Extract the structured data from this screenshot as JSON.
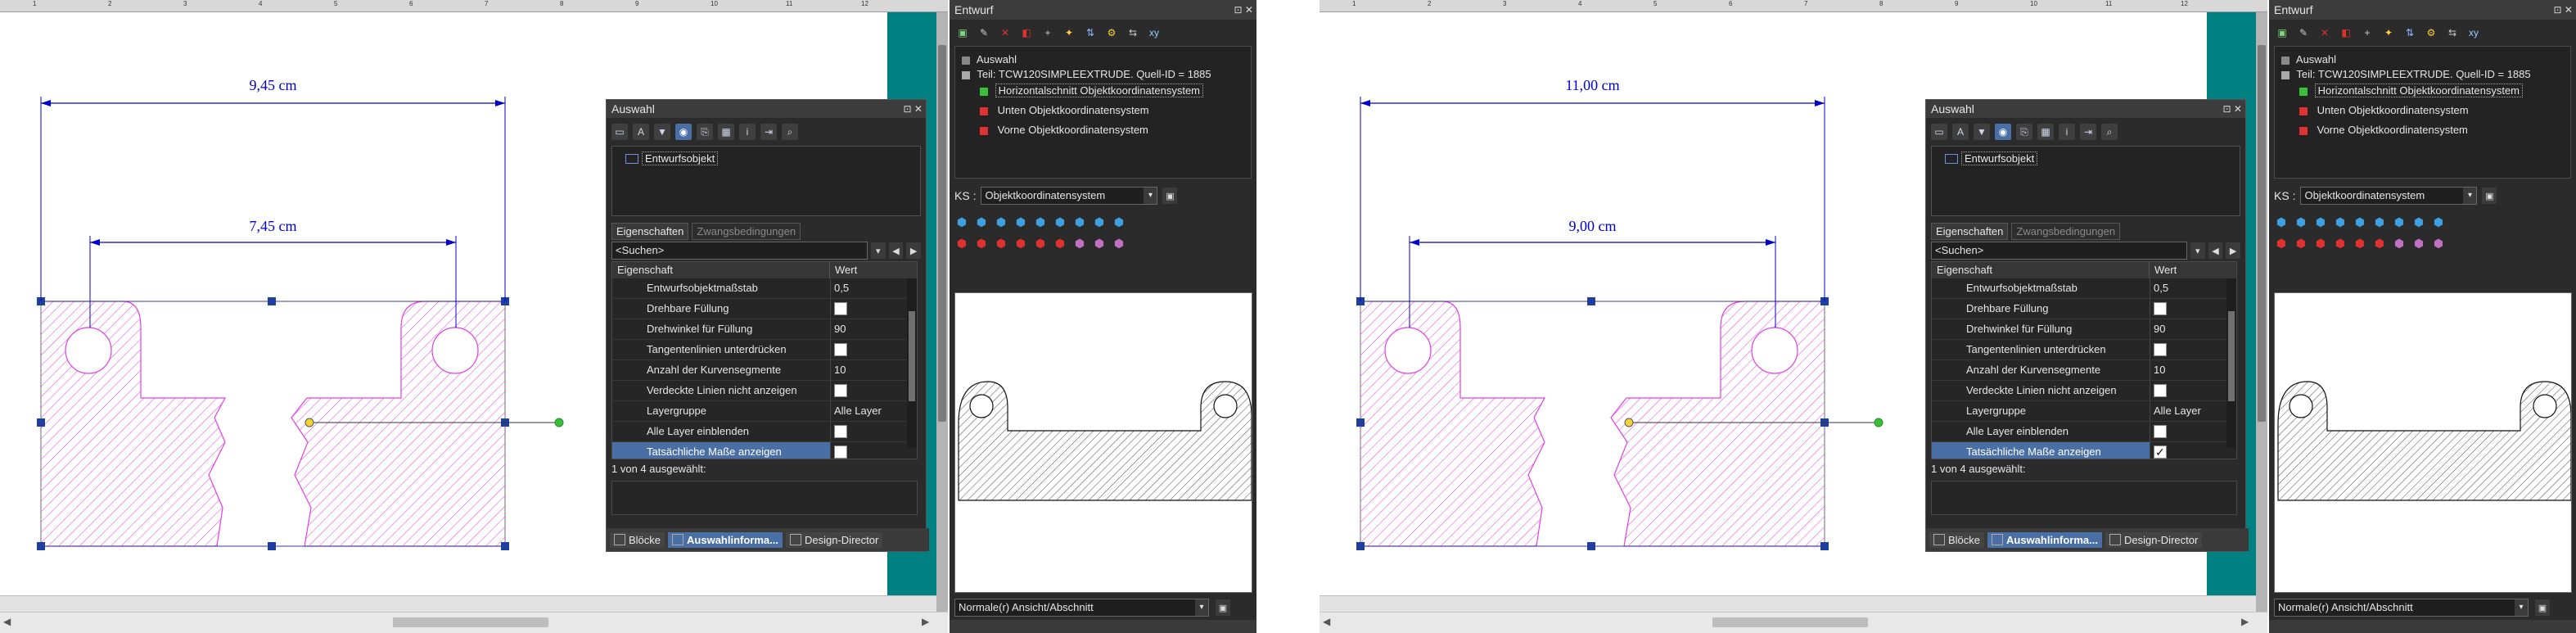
{
  "panels": [
    {
      "ruler_ticks": [
        "1",
        "2",
        "3",
        "4",
        "5",
        "6",
        "7",
        "8",
        "9",
        "10",
        "11",
        "12"
      ],
      "dimensions": {
        "outer": "9,45 cm",
        "inner": "7,45 cm"
      },
      "auswahl": {
        "title": "Auswahl",
        "title_buttons": "⊡ ✕",
        "tree_node": "Entwurfsobjekt",
        "tabs": {
          "properties": "Eigenschaften",
          "constraints": "Zwangsbedingungen"
        },
        "search": "<Suchen>",
        "header": {
          "property": "Eigenschaft",
          "value": "Wert"
        },
        "rows": [
          {
            "label": "Entwurfsobjektmaßstab",
            "value": "0,5",
            "type": "text"
          },
          {
            "label": "Drehbare Füllung",
            "value": "",
            "type": "check",
            "checked": false
          },
          {
            "label": "Drehwinkel für Füllung",
            "value": "90",
            "type": "text"
          },
          {
            "label": "Tangentenlinien unterdrücken",
            "value": "",
            "type": "check",
            "checked": false
          },
          {
            "label": "Anzahl der Kurvensegmente",
            "value": "10",
            "type": "text"
          },
          {
            "label": "Verdeckte Linien nicht anzeigen",
            "value": "",
            "type": "check",
            "checked": false
          },
          {
            "label": "Layergruppe",
            "value": "Alle Layer",
            "type": "text"
          },
          {
            "label": "Alle Layer einblenden",
            "value": "",
            "type": "check",
            "checked": false
          },
          {
            "label": "Tatsächliche Maße anzeigen",
            "value": "",
            "type": "check",
            "checked": false,
            "selected": true
          }
        ],
        "status": "1 von 4 ausgewählt:",
        "bottom_tabs": [
          "Blöcke",
          "Auswahlinforma...",
          "Design-Director"
        ]
      },
      "entwurf": {
        "title": "Entwurf",
        "tree": {
          "root": "Auswahl",
          "part": "Teil: TCW120SIMPLEEXTRUDE. Quell-ID = 1885",
          "children": [
            "Horizontalschnitt Objektkoordinatensystem",
            "Unten Objektkoordinatensystem",
            "Vorne Objektkoordinatensystem"
          ]
        },
        "ks_label": "KS :",
        "ks_value": "Objektkoordinatensystem",
        "view_value": "Normale(r) Ansicht/Abschnitt"
      }
    },
    {
      "ruler_ticks": [
        "1",
        "2",
        "3",
        "4",
        "5",
        "6",
        "7",
        "8",
        "9",
        "10",
        "11",
        "12"
      ],
      "dimensions": {
        "outer": "11,00 cm",
        "inner": "9,00 cm"
      },
      "auswahl": {
        "title": "Auswahl",
        "title_buttons": "⊡ ✕",
        "tree_node": "Entwurfsobjekt",
        "tabs": {
          "properties": "Eigenschaften",
          "constraints": "Zwangsbedingungen"
        },
        "search": "<Suchen>",
        "header": {
          "property": "Eigenschaft",
          "value": "Wert"
        },
        "rows": [
          {
            "label": "Entwurfsobjektmaßstab",
            "value": "0,5",
            "type": "text"
          },
          {
            "label": "Drehbare Füllung",
            "value": "",
            "type": "check",
            "checked": false
          },
          {
            "label": "Drehwinkel für Füllung",
            "value": "90",
            "type": "text"
          },
          {
            "label": "Tangentenlinien unterdrücken",
            "value": "",
            "type": "check",
            "checked": false
          },
          {
            "label": "Anzahl der Kurvensegmente",
            "value": "10",
            "type": "text"
          },
          {
            "label": "Verdeckte Linien nicht anzeigen",
            "value": "",
            "type": "check",
            "checked": false
          },
          {
            "label": "Layergruppe",
            "value": "Alle Layer",
            "type": "text"
          },
          {
            "label": "Alle Layer einblenden",
            "value": "",
            "type": "check",
            "checked": false
          },
          {
            "label": "Tatsächliche Maße anzeigen",
            "value": "",
            "type": "check",
            "checked": true,
            "selected": true
          }
        ],
        "status": "1 von 4 ausgewählt:",
        "bottom_tabs": [
          "Blöcke",
          "Auswahlinforma...",
          "Design-Director"
        ]
      },
      "entwurf": {
        "title": "Entwurf",
        "tree": {
          "root": "Auswahl",
          "part": "Teil: TCW120SIMPLEEXTRUDE. Quell-ID = 1885",
          "children": [
            "Horizontalschnitt Objektkoordinatensystem",
            "Unten Objektkoordinatensystem",
            "Vorne Objektkoordinatensystem"
          ]
        },
        "ks_label": "KS :",
        "ks_value": "Objektkoordinatensystem",
        "view_value": "Normale(r) Ansicht/Abschnitt"
      }
    }
  ],
  "colors": {
    "teal": "#008080",
    "hatch": "#e040e0",
    "dimension": "#0000cc",
    "selection": "#4a6fa5"
  }
}
